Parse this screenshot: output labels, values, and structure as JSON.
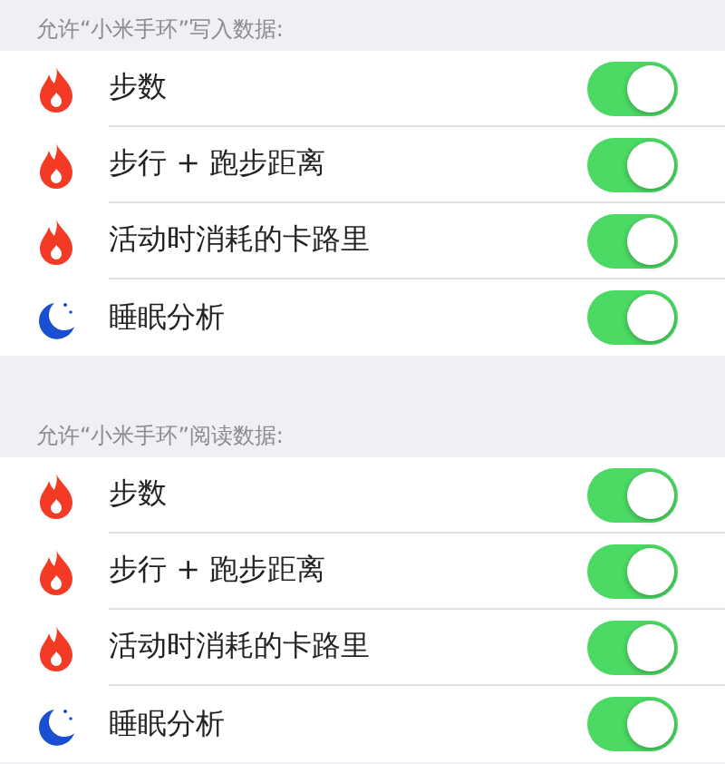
{
  "sections": [
    {
      "header": "允许“小米手环”写入数据:",
      "items": [
        {
          "kind": "flame",
          "label": "步数",
          "on": true
        },
        {
          "kind": "flame",
          "label": "步行 + 跑步距离",
          "on": true
        },
        {
          "kind": "flame",
          "label": "活动时消耗的卡路里",
          "on": true
        },
        {
          "kind": "moon",
          "label": "睡眠分析",
          "on": true
        }
      ]
    },
    {
      "header": "允许“小米手环”阅读数据:",
      "items": [
        {
          "kind": "flame",
          "label": "步数",
          "on": true
        },
        {
          "kind": "flame",
          "label": "步行 + 跑步距离",
          "on": true
        },
        {
          "kind": "flame",
          "label": "活动时消耗的卡路里",
          "on": true
        },
        {
          "kind": "moon",
          "label": "睡眠分析",
          "on": true
        }
      ]
    }
  ]
}
